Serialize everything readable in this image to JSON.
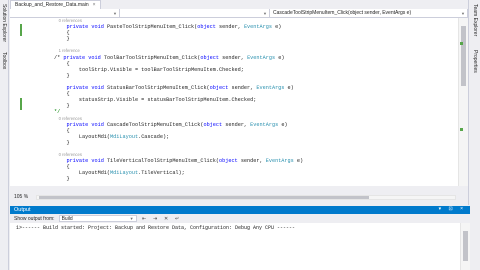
{
  "left_tabs": [
    "Solution Explorer",
    "Toolbox"
  ],
  "right_tabs": [
    "Team Explorer",
    "Properties"
  ],
  "doc_tab": {
    "label": "Backup_and_Restore_Data.main",
    "close": "×"
  },
  "nav": {
    "member": "CascadeToolStripMenuItem_Click(object sender, EventArgs e)"
  },
  "code_lines": [
    [
      {
        "t": "    0 references",
        "c": "ref"
      }
    ],
    [
      {
        "t": "    "
      },
      {
        "t": "private",
        "c": "kw"
      },
      {
        "t": " "
      },
      {
        "t": "void",
        "c": "kw"
      },
      {
        "t": " PasteToolStripMenuItem_Click("
      },
      {
        "t": "object",
        "c": "kw"
      },
      {
        "t": " sender, "
      },
      {
        "t": "EventArgs",
        "c": "ty"
      },
      {
        "t": " e)"
      }
    ],
    [
      {
        "t": "    {"
      }
    ],
    [
      {
        "t": "    }"
      }
    ],
    [
      {
        "t": ""
      }
    ],
    [
      {
        "t": "    1 reference",
        "c": "ref"
      }
    ],
    [
      {
        "t": "/* "
      },
      {
        "t": "private",
        "c": "kw"
      },
      {
        "t": " "
      },
      {
        "t": "void",
        "c": "kw"
      },
      {
        "t": " ToolBarToolStripMenuItem_Click("
      },
      {
        "t": "object",
        "c": "kw"
      },
      {
        "t": " sender, "
      },
      {
        "t": "EventArgs",
        "c": "ty"
      },
      {
        "t": " e)"
      }
    ],
    [
      {
        "t": "    {"
      }
    ],
    [
      {
        "t": "        toolStrip.Visible = toolBarToolStripMenuItem.Checked;"
      }
    ],
    [
      {
        "t": "    }"
      }
    ],
    [
      {
        "t": ""
      }
    ],
    [
      {
        "t": "    "
      },
      {
        "t": "private",
        "c": "kw"
      },
      {
        "t": " "
      },
      {
        "t": "void",
        "c": "kw"
      },
      {
        "t": " StatusBarToolStripMenuItem_Click("
      },
      {
        "t": "object",
        "c": "kw"
      },
      {
        "t": " sender, "
      },
      {
        "t": "EventArgs",
        "c": "ty"
      },
      {
        "t": " e)"
      }
    ],
    [
      {
        "t": "    {"
      }
    ],
    [
      {
        "t": "        statusStrip.Visible = statusBarToolStripMenuItem.Checked;"
      }
    ],
    [
      {
        "t": "    }"
      }
    ],
    [
      {
        "t": "*/",
        "c": "cm"
      }
    ],
    [
      {
        "t": "    0 references",
        "c": "ref"
      }
    ],
    [
      {
        "t": "    "
      },
      {
        "t": "private",
        "c": "kw"
      },
      {
        "t": " "
      },
      {
        "t": "void",
        "c": "kw"
      },
      {
        "t": " CascadeToolStripMenuItem_Click("
      },
      {
        "t": "object",
        "c": "kw"
      },
      {
        "t": " sender, "
      },
      {
        "t": "EventArgs",
        "c": "ty"
      },
      {
        "t": " e)"
      }
    ],
    [
      {
        "t": "    {"
      }
    ],
    [
      {
        "t": "        LayoutMdi("
      },
      {
        "t": "MdiLayout",
        "c": "ty"
      },
      {
        "t": ".Cascade);"
      }
    ],
    [
      {
        "t": "    }"
      }
    ],
    [
      {
        "t": ""
      }
    ],
    [
      {
        "t": "    0 references",
        "c": "ref"
      }
    ],
    [
      {
        "t": "    "
      },
      {
        "t": "private",
        "c": "kw"
      },
      {
        "t": " "
      },
      {
        "t": "void",
        "c": "kw"
      },
      {
        "t": " TileVerticalToolStripMenuItem_Click("
      },
      {
        "t": "object",
        "c": "kw"
      },
      {
        "t": " sender, "
      },
      {
        "t": "EventArgs",
        "c": "ty"
      },
      {
        "t": " e)"
      }
    ],
    [
      {
        "t": "    {"
      }
    ],
    [
      {
        "t": "        LayoutMdi("
      },
      {
        "t": "MdiLayout",
        "c": "ty"
      },
      {
        "t": ".TileVertical);"
      }
    ],
    [
      {
        "t": "    }"
      }
    ]
  ],
  "zoom": "105 %",
  "output": {
    "title": "Output",
    "buttons": "▾ ⊡ ×",
    "show_label": "Show output from:",
    "source": "Build",
    "text": "1>------ Build started: Project: Backup and Restore Data, Configuration: Debug Any CPU ------"
  }
}
